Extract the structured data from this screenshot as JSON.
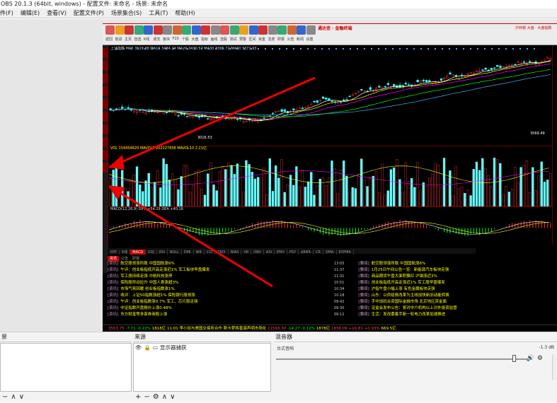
{
  "title": "OBS 20.1.3 (64bit, windows) - 配置文件: 未命名 - 场景: 未命名",
  "menu": [
    "件(F)",
    "编辑(E)",
    "查看(V)",
    "配置文件(P)",
    "场景集合(S)",
    "工具(T)",
    "帮助(H)"
  ],
  "tdx": {
    "brand": "通达信 · 金融终端",
    "ad": "沪商银 大盘 · 大盘指数",
    "toolbar": [
      "返回",
      "前进",
      "主页",
      "自选",
      "K线",
      "成交",
      "板块",
      "F10",
      "个股",
      "大盘",
      "指标",
      "画线",
      "选股",
      "测试",
      "预警",
      "区间",
      "资金",
      "龙虎",
      "研报",
      "公告",
      "新闻",
      "设置"
    ],
    "main_info": "上证指数  MA5 3529.38  MA10 3484.24  MA20 3430.57  MA30 3395.72  MA60 3371.93",
    "main_high": "3569.49",
    "main_low": "3016.53",
    "vol_info": "VOL 154454620  MAVOL5 202227658  MAVOL10 2.21亿",
    "macd_info": "MACD(12,26,9)  DIFF +54.29  DEA +40.18",
    "chart_tabs": [
      "分时",
      "K线",
      "MACD",
      "KDJ",
      "RSI",
      "BOLL",
      "DMI",
      "WR",
      "CCI",
      "TRIX",
      "BIAS",
      "VR",
      "OBV",
      "ASI",
      "EMV",
      "PSY",
      "ARBR",
      "CR",
      "DMA",
      "EXPMA"
    ],
    "news_tabs": [
      "资讯",
      "公告",
      "研报"
    ],
    "news_left": [
      {
        "tag": "[资讯]",
        "text": "航空股领涨所致 中国国航涨6%",
        "time": ""
      },
      {
        "tag": "[资讯]",
        "text": "午评：创业板指低开高走涨近1% 军工板块早盘爆发",
        "time": ""
      },
      {
        "tag": "[资讯]",
        "text": "军工股持续走强 中航科技涨停",
        "time": ""
      },
      {
        "tag": "[资讯]",
        "text": "保险股异动拉升 中国人寿涨超3%",
        "time": ""
      },
      {
        "tag": "[资讯]",
        "text": "市场气氛回暖 创业板指数涨1%",
        "time": ""
      },
      {
        "tag": "[资讯]",
        "text": "收评：上证50指数涨超1% 保险银行股领涨",
        "time": ""
      },
      {
        "tag": "[资讯]",
        "text": "午评：创业板指数涨0.7% 军工、芯片股走强",
        "time": ""
      },
      {
        "tag": "[资讯]",
        "text": "中证指数开盘报价上涨0.48%",
        "time": ""
      },
      {
        "tag": "[资讯]",
        "text": "东方财富等多家券商股上涨",
        "time": ""
      }
    ],
    "news_right": [
      {
        "tag": "[要闻]",
        "text": "航空股领涨所致 中国国航涨6%",
        "time": "13:05"
      },
      {
        "tag": "[要闻]",
        "text": "1月25日午间公告一览：新能源汽车板块走强",
        "time": "11:37"
      },
      {
        "tag": "[要闻]",
        "text": "商品期货午盘大面积飘红 沪镍涨近3%",
        "time": "11:31"
      },
      {
        "tag": "[要闻]",
        "text": "创业板指低开高走涨近1% 军工股早盘爆发",
        "time": "10:51"
      },
      {
        "tag": "[要闻]",
        "text": "沪指午盘小幅上涨 有色金属板块走强",
        "time": "10:34"
      },
      {
        "tag": "[要闻]",
        "text": "山东：以供给侧改革为主线加快新旧动能转换",
        "time": "10:18"
      },
      {
        "tag": "[要闻]",
        "text": "手中加码合资国际金融市场 北京地区资金面",
        "time": "09:42"
      },
      {
        "tag": "[要闻]",
        "text": "证监会发布公告：将对中介机构以上对外投资监管",
        "time": "09:30"
      },
      {
        "tag": "[要闻]",
        "text": "生活：发改委着手新一轮电力改革加速推进",
        "time": "09:12"
      }
    ],
    "ticker": [
      {
        "text": "3553.75",
        "cls": "r"
      },
      {
        "text": "-7.71",
        "cls": "g"
      },
      {
        "text": "-0.22%",
        "cls": "g"
      },
      {
        "text": "1818亿",
        "cls": "y"
      },
      {
        "text": "11593.30",
        "cls": "r"
      },
      {
        "text": "-14.27",
        "cls": "g"
      },
      {
        "text": "-0.12%",
        "cls": "g"
      },
      {
        "text": "1878亿",
        "cls": "y"
      },
      {
        "text": "1836.09",
        "cls": "r"
      },
      {
        "text": "+16.81",
        "cls": "r"
      },
      {
        "text": "+0.93%",
        "cls": "r"
      },
      {
        "text": "669.5亿",
        "cls": "y"
      }
    ],
    "ticker_msg": "11:01 李小加与美国交易所合作 斯卡梦将香港声明市场化"
  },
  "dock": {
    "scenes": {
      "header": "景",
      "item": ""
    },
    "sources": {
      "header": "来源",
      "item": "显示器捕获"
    },
    "mixer": {
      "header": "混音器",
      "channel": "台式音响",
      "db": "-1.3 dB"
    }
  }
}
